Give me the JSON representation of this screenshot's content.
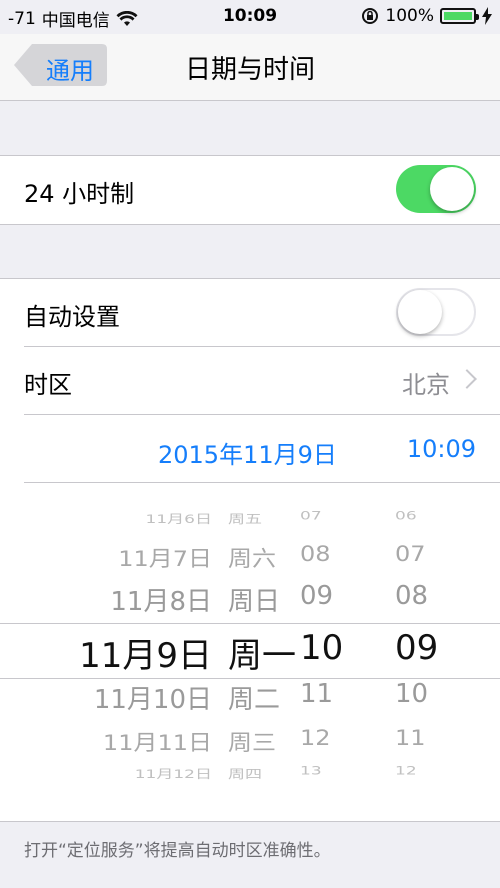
{
  "status_bar": {
    "signal": "-71",
    "carrier": "中国电信",
    "time": "10:09",
    "battery": "100%"
  },
  "nav": {
    "back_label": "通用",
    "title": "日期与时间"
  },
  "group1": {
    "hour24_label": "24 小时制",
    "hour24_on": true
  },
  "group2": {
    "auto_label": "自动设置",
    "auto_on": false,
    "timezone_label": "时区",
    "timezone_value": "北京",
    "selected_date": "2015年11月9日",
    "selected_time": "10:09"
  },
  "picker": {
    "rows": [
      {
        "date": "11月6日",
        "weekday": "周五",
        "hour": "07",
        "minute": "06"
      },
      {
        "date": "11月7日",
        "weekday": "周六",
        "hour": "08",
        "minute": "07"
      },
      {
        "date": "11月8日",
        "weekday": "周日",
        "hour": "09",
        "minute": "08"
      },
      {
        "date": "11月9日",
        "weekday": "周一",
        "hour": "10",
        "minute": "09"
      },
      {
        "date": "11月10日",
        "weekday": "周二",
        "hour": "11",
        "minute": "10"
      },
      {
        "date": "11月11日",
        "weekday": "周三",
        "hour": "12",
        "minute": "11"
      },
      {
        "date": "11月12日",
        "weekday": "周四",
        "hour": "13",
        "minute": "12"
      }
    ]
  },
  "footer": "打开“定位服务”将提高自动时区准确性。",
  "colors": {
    "accent": "#157efb",
    "toggle_on": "#4cd964"
  }
}
